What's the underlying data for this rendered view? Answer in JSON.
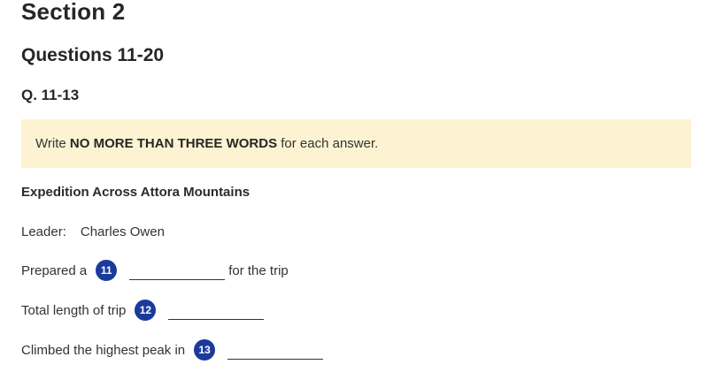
{
  "section": {
    "title": "Section 2"
  },
  "questions": {
    "title": "Questions 11-20"
  },
  "group": {
    "range": "Q. 11-13"
  },
  "instruction": {
    "prefix": "Write",
    "emphasis": "NO MORE THAN THREE WORDS",
    "suffix": "for each answer."
  },
  "form": {
    "title": "Expedition Across Attora Mountains",
    "leader": {
      "label": "Leader:",
      "value": "Charles Owen"
    },
    "items": [
      {
        "number": "11",
        "before": "Prepared a",
        "after": "for the trip",
        "answer": ""
      },
      {
        "number": "12",
        "before": "Total length of trip",
        "after": "",
        "answer": ""
      },
      {
        "number": "13",
        "before": "Climbed the highest peak in",
        "after": "",
        "answer": ""
      }
    ]
  },
  "colors": {
    "badge": "#1a3a9c",
    "instruction_bg": "#fdf3d2",
    "text": "#333333"
  }
}
